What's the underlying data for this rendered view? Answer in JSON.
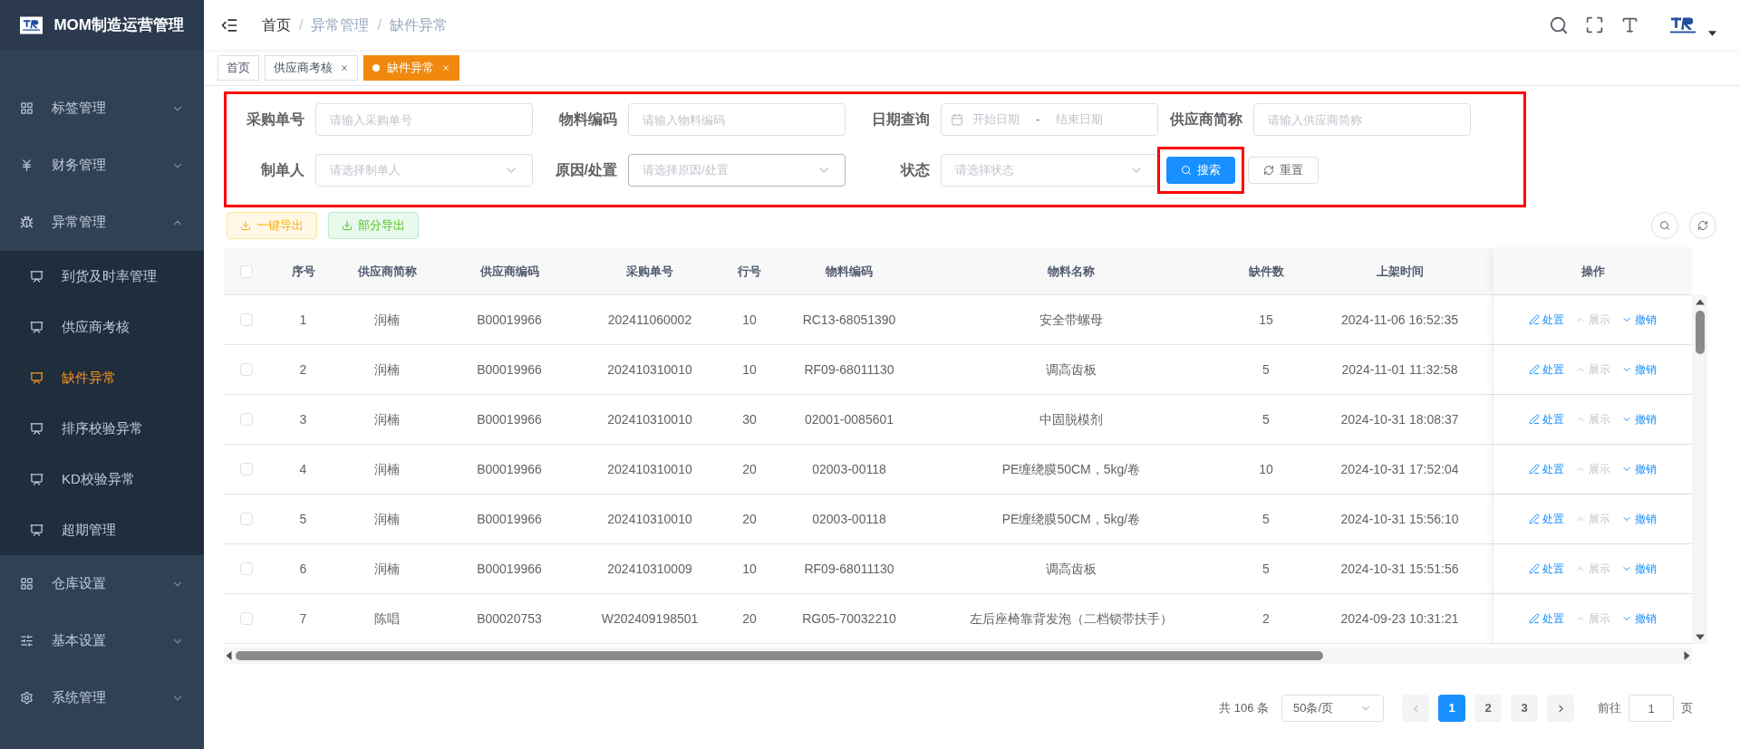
{
  "app": {
    "title": "MOM制造运营管理"
  },
  "sidebar": {
    "items": [
      {
        "label": "标签管理",
        "expanded": false
      },
      {
        "label": "财务管理",
        "expanded": false
      },
      {
        "label": "异常管理",
        "expanded": true,
        "children": [
          {
            "label": "到货及时率管理",
            "selected": false
          },
          {
            "label": "供应商考核",
            "selected": false
          },
          {
            "label": "缺件异常",
            "selected": true
          },
          {
            "label": "排序校验异常",
            "selected": false
          },
          {
            "label": "KD校验异常",
            "selected": false
          },
          {
            "label": "超期管理",
            "selected": false
          }
        ]
      },
      {
        "label": "仓库设置",
        "expanded": false
      },
      {
        "label": "基本设置",
        "expanded": false
      },
      {
        "label": "系统管理",
        "expanded": false
      }
    ]
  },
  "breadcrumb": [
    {
      "label": "首页"
    },
    {
      "separator": "/",
      "label": "异常管理"
    },
    {
      "separator": "/",
      "label": "缺件异常"
    }
  ],
  "tabs": [
    {
      "label": "首页",
      "closable": false,
      "selected": false
    },
    {
      "label": "供应商考核",
      "closable": true,
      "selected": false
    },
    {
      "label": "缺件异常",
      "closable": true,
      "selected": true
    }
  ],
  "filters": [
    {
      "label": "采购单号",
      "kind": "input",
      "placeholder": "请输入采购单号"
    },
    {
      "label": "物料编码",
      "kind": "input",
      "placeholder": "请输入物料编码"
    },
    {
      "label": "日期查询",
      "kind": "daterange",
      "start_placeholder": "开始日期",
      "separator": "-",
      "end_placeholder": "结束日期"
    },
    {
      "label": "供应商简称",
      "kind": "input",
      "placeholder": "请输入供应商简称"
    },
    {
      "label": "制单人",
      "kind": "select",
      "placeholder": "请选择制单人"
    },
    {
      "label": "原因/处置",
      "kind": "select",
      "placeholder": "请选择原因/处置"
    },
    {
      "label": "状态",
      "kind": "select",
      "placeholder": "请选择状态"
    }
  ],
  "search_button": "搜索",
  "reset_button": "重置",
  "export_buttons": [
    {
      "label": "一键导出",
      "kind": "warning"
    },
    {
      "label": "部分导出",
      "kind": "success"
    }
  ],
  "table": {
    "all_checked": false,
    "columns": [
      "序号",
      "供应商简称",
      "供应商编码",
      "采购单号",
      "行号",
      "物料编码",
      "物料名称",
      "缺件数",
      "上架时间",
      "操作"
    ],
    "rows": [
      {
        "checked": false,
        "cells": [
          "1",
          "润楠",
          "B00019966",
          "202411060002",
          "10",
          "RC13-68051390",
          "安全带螺母",
          "15",
          "2024-11-06 16:52:35"
        ],
        "actions": [
          {
            "label": "处置",
            "kind": "edit",
            "disabled": false
          },
          {
            "label": "展示",
            "kind": "expand",
            "disabled": true
          },
          {
            "label": "撤销",
            "kind": "collapse",
            "disabled": false
          }
        ]
      },
      {
        "checked": false,
        "cells": [
          "2",
          "润楠",
          "B00019966",
          "202410310010",
          "10",
          "RF09-68011130",
          "调高齿板",
          "5",
          "2024-11-01 11:32:58"
        ],
        "actions": [
          {
            "label": "处置",
            "kind": "edit",
            "disabled": false
          },
          {
            "label": "展示",
            "kind": "expand",
            "disabled": true
          },
          {
            "label": "撤销",
            "kind": "collapse",
            "disabled": false
          }
        ]
      },
      {
        "checked": false,
        "cells": [
          "3",
          "润楠",
          "B00019966",
          "202410310010",
          "30",
          "02001-0085601",
          "中固脱模剂",
          "5",
          "2024-10-31 18:08:37"
        ],
        "actions": [
          {
            "label": "处置",
            "kind": "edit",
            "disabled": false
          },
          {
            "label": "展示",
            "kind": "expand",
            "disabled": true
          },
          {
            "label": "撤销",
            "kind": "collapse",
            "disabled": false
          }
        ]
      },
      {
        "checked": false,
        "cells": [
          "4",
          "润楠",
          "B00019966",
          "202410310010",
          "20",
          "02003-00118",
          "PE缠绕膜50CM，5kg/卷",
          "10",
          "2024-10-31 17:52:04"
        ],
        "actions": [
          {
            "label": "处置",
            "kind": "edit",
            "disabled": false
          },
          {
            "label": "展示",
            "kind": "expand",
            "disabled": true
          },
          {
            "label": "撤销",
            "kind": "collapse",
            "disabled": false
          }
        ]
      },
      {
        "checked": false,
        "cells": [
          "5",
          "润楠",
          "B00019966",
          "202410310010",
          "20",
          "02003-00118",
          "PE缠绕膜50CM，5kg/卷",
          "5",
          "2024-10-31 15:56:10"
        ],
        "actions": [
          {
            "label": "处置",
            "kind": "edit",
            "disabled": false
          },
          {
            "label": "展示",
            "kind": "expand",
            "disabled": true
          },
          {
            "label": "撤销",
            "kind": "collapse",
            "disabled": false
          }
        ]
      },
      {
        "checked": false,
        "cells": [
          "6",
          "润楠",
          "B00019966",
          "202410310009",
          "10",
          "RF09-68011130",
          "调高齿板",
          "5",
          "2024-10-31 15:51:56"
        ],
        "actions": [
          {
            "label": "处置",
            "kind": "edit",
            "disabled": false
          },
          {
            "label": "展示",
            "kind": "expand",
            "disabled": true
          },
          {
            "label": "撤销",
            "kind": "collapse",
            "disabled": false
          }
        ]
      },
      {
        "checked": false,
        "cells": [
          "7",
          "陈唱",
          "B00020753",
          "W202409198501",
          "20",
          "RG05-70032210",
          "左后座椅靠背发泡（二档锁带扶手）",
          "2",
          "2024-09-23 10:31:21"
        ],
        "actions": [
          {
            "label": "处置",
            "kind": "edit",
            "disabled": false
          },
          {
            "label": "展示",
            "kind": "expand",
            "disabled": true
          },
          {
            "label": "撤销",
            "kind": "collapse",
            "disabled": false
          }
        ]
      }
    ]
  },
  "pagination": {
    "total": "共 106 条",
    "page_size": "50条/页",
    "pages": [
      {
        "label": "1",
        "selected": true
      },
      {
        "label": "2",
        "selected": false
      },
      {
        "label": "3",
        "selected": false
      }
    ],
    "goto_label": "前往",
    "goto_value": "1",
    "goto_suffix": "页"
  }
}
